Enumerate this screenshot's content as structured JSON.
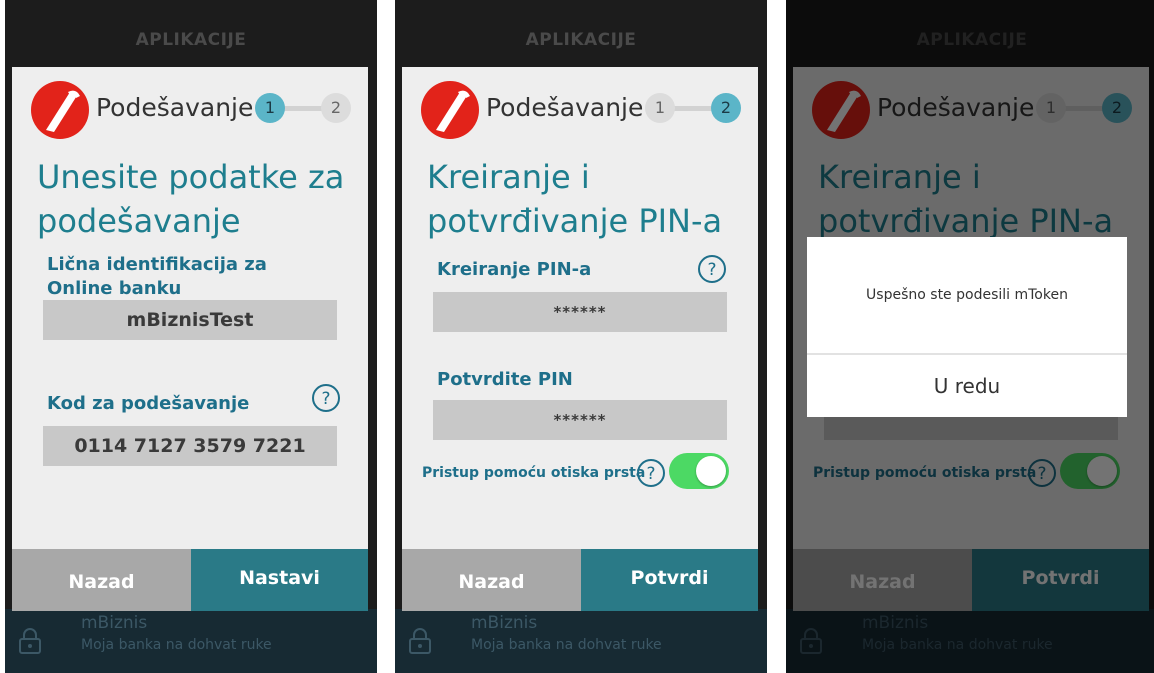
{
  "background": {
    "title": "APLIKACIJE",
    "app_name": "mBiznis",
    "app_subtitle": "Moja banka na dohvat ruke"
  },
  "header": {
    "title": "Podešavanje",
    "step1": "1",
    "step2": "2"
  },
  "screen1": {
    "headline": "Unesite podatke za podešavanje",
    "id_label": "Lična identifikacija za Online banku",
    "id_value": "mBiznisTest",
    "code_label": "Kod za podešavanje",
    "code_value": "0114 7127 3579 7221",
    "back_label": "Nazad",
    "next_label": "Nastavi",
    "active_step": 1
  },
  "screen2": {
    "headline": "Kreiranje i potvrđivanje PIN-a",
    "create_pin_label": "Kreiranje PIN-a",
    "create_pin_value": "******",
    "confirm_pin_label": "Potvrdite PIN",
    "confirm_pin_value": "******",
    "fingerprint_label": "Pristup pomoću otiska prsta",
    "fingerprint_enabled": true,
    "back_label": "Nazad",
    "confirm_label": "Potvrdi",
    "active_step": 2
  },
  "screen3": {
    "alert_message": "Uspešno ste podesili mToken",
    "alert_ok": "U redu"
  },
  "colors": {
    "accent": "#2a7a87",
    "step_active": "#5bb5c8",
    "toggle_on": "#4cd964",
    "brand_red": "#e2231a"
  },
  "icons": [
    "unicredit-logo-icon",
    "help-icon",
    "lock-icon"
  ]
}
